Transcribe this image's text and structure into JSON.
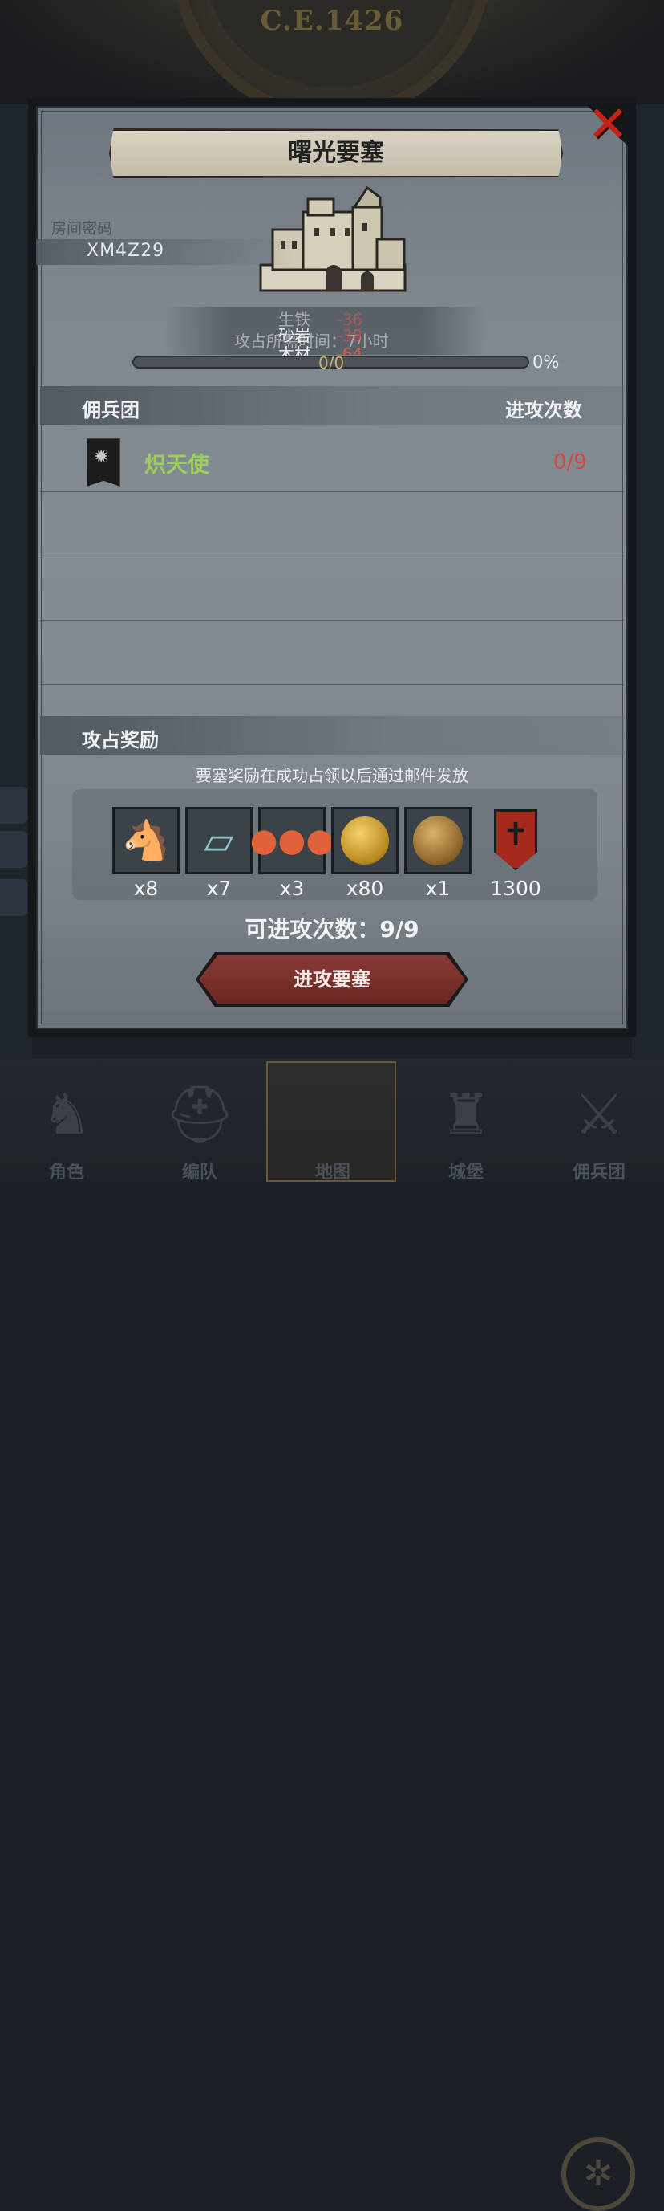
{
  "header": {
    "era": "C.E.1426"
  },
  "dialog": {
    "title": "曙光要塞",
    "room_label": "房间密码",
    "room_code": "XM4Z29",
    "resources": [
      {
        "name": "生铁",
        "value": "-36"
      },
      {
        "name": "砂岩",
        "value": "-38"
      },
      {
        "name": "木材",
        "value": "-64"
      }
    ],
    "capture_time_text": "攻占所需时间：7小时",
    "progress": {
      "text": "0/0",
      "percent_label": "0%",
      "fraction": 0
    },
    "mercenary_section": {
      "title": "佣兵团",
      "attack_count_header": "进攻次数",
      "rows": [
        {
          "name": "炽天使",
          "count": "0/9"
        }
      ]
    },
    "reward_section": {
      "title": "攻占奖励",
      "note": "要塞奖励在成功占领以后通过邮件发放",
      "items": [
        {
          "icon": "horse-icon",
          "qty": "x8"
        },
        {
          "icon": "cloth-icon",
          "qty": "x7"
        },
        {
          "icon": "berries-icon",
          "qty": "x3"
        },
        {
          "icon": "gold-coin-icon",
          "qty": "x80"
        },
        {
          "icon": "helmet-coin-icon",
          "qty": "x1"
        },
        {
          "icon": "guild-shield-icon",
          "qty": "1300"
        }
      ]
    },
    "attack_count": "可进攻次数：9/9",
    "attack_button": "进攻要塞",
    "close_icon": "close-icon"
  },
  "bottom_nav": {
    "items": [
      {
        "label": "角色",
        "icon": "knight-icon"
      },
      {
        "label": "编队",
        "icon": "helmet-icon"
      },
      {
        "label": "地图",
        "icon": "compass-icon"
      },
      {
        "label": "城堡",
        "icon": "castle-icon"
      },
      {
        "label": "佣兵团",
        "icon": "mercenary-icon"
      }
    ],
    "active_index": 2
  },
  "colors": {
    "mercenary_name": "#9ccf5a",
    "negative": "#d75a4d",
    "close": "#c5221a",
    "attack_button": "#7a302b"
  }
}
